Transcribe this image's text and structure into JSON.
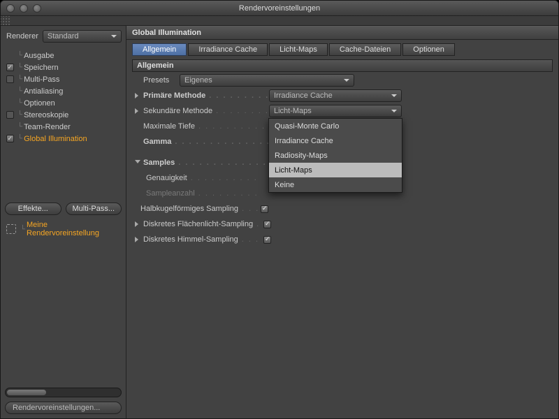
{
  "window": {
    "title": "Rendervoreinstellungen"
  },
  "sidebar": {
    "renderer_label": "Renderer",
    "renderer_value": "Standard",
    "items": [
      {
        "label": "Ausgabe",
        "checked": null
      },
      {
        "label": "Speichern",
        "checked": true
      },
      {
        "label": "Multi-Pass",
        "checked": false
      },
      {
        "label": "Antialiasing",
        "checked": null
      },
      {
        "label": "Optionen",
        "checked": null
      },
      {
        "label": "Stereoskopie",
        "checked": false
      },
      {
        "label": "Team-Render",
        "checked": null
      },
      {
        "label": "Global Illumination",
        "checked": true,
        "selected": true
      }
    ],
    "btn_effects": "Effekte...",
    "btn_multipass": "Multi-Pass...",
    "preset_label": "Meine Rendervoreinstellung",
    "footer_button": "Rendervoreinstellungen..."
  },
  "panel": {
    "title": "Global Illumination",
    "tabs": [
      "Allgemein",
      "Irradiance Cache",
      "Licht-Maps",
      "Cache-Dateien",
      "Optionen"
    ],
    "active_tab": 0,
    "section": "Allgemein",
    "presets_label": "Presets",
    "presets_value": "Eigenes",
    "primary_label": "Primäre Methode",
    "primary_value": "Irradiance Cache",
    "secondary_label": "Sekundäre Methode",
    "secondary_value": "Licht-Maps",
    "secondary_options": [
      "Quasi-Monte Carlo",
      "Irradiance Cache",
      "Radiosity-Maps",
      "Licht-Maps",
      "Keine"
    ],
    "secondary_highlight": "Licht-Maps",
    "depth_label": "Maximale Tiefe",
    "gamma_label": "Gamma",
    "samples_label": "Samples",
    "accuracy_label": "Genauigkeit",
    "samplecount_label": "Sampleanzahl",
    "hemi_label": "Halbkugelförmiges Sampling",
    "area_label": "Diskretes Flächenlicht-Sampling",
    "sky_label": "Diskretes Himmel-Sampling"
  }
}
